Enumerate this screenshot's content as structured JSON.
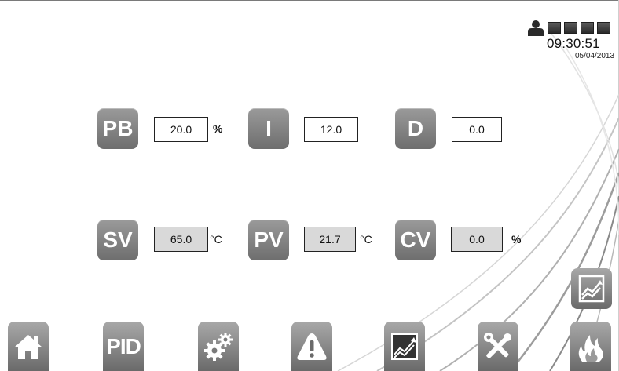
{
  "status": {
    "time": "09:30:51",
    "date": "05/04/2013",
    "indicator_count": 4
  },
  "pid": {
    "pb": {
      "label": "PB",
      "value": "20.0",
      "unit": "%"
    },
    "i": {
      "label": "I",
      "value": "12.0"
    },
    "d": {
      "label": "D",
      "value": "0.0"
    }
  },
  "process": {
    "sv": {
      "label": "SV",
      "value": "65.0",
      "unit": "°C"
    },
    "pv": {
      "label": "PV",
      "value": "21.7",
      "unit": "°C"
    },
    "cv": {
      "label": "CV",
      "value": "0.0",
      "unit": "%"
    }
  },
  "nav": {
    "home": {
      "icon": "home-icon"
    },
    "pid": {
      "label": "PID"
    },
    "settings": {
      "icon": "gears-icon"
    },
    "alarm": {
      "icon": "alert-icon"
    },
    "trend": {
      "icon": "trend-chart-icon"
    },
    "tools": {
      "icon": "tools-icon"
    },
    "fire": {
      "icon": "flame-icon"
    }
  },
  "colors": {
    "tile": "#808080",
    "readonly_field": "#d9d9d9",
    "background": "#ffffff"
  }
}
